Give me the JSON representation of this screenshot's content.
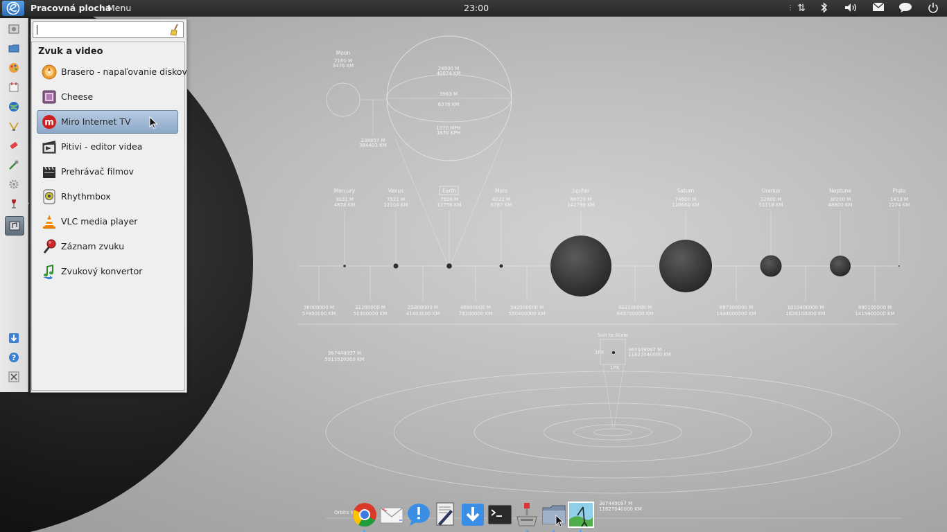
{
  "top_panel": {
    "desktop_label": "Pracovná plocha",
    "menu_label": "Menu",
    "clock": "23:00"
  },
  "search": {
    "value": "",
    "placeholder": ""
  },
  "menu": {
    "category": "Zvuk a video",
    "items": [
      {
        "label": "Brasero - napaľovanie diskov",
        "icon": "disc-burner-icon"
      },
      {
        "label": "Cheese",
        "icon": "webcam-icon"
      },
      {
        "label": "Miro Internet TV",
        "icon": "miro-icon",
        "selected": true
      },
      {
        "label": "Pitivi - editor videa",
        "icon": "video-editor-icon"
      },
      {
        "label": "Prehrávač filmov",
        "icon": "clapperboard-icon"
      },
      {
        "label": "Rhythmbox",
        "icon": "rhythmbox-icon"
      },
      {
        "label": "VLC media player",
        "icon": "vlc-cone-icon"
      },
      {
        "label": "Záznam zvuku",
        "icon": "microphone-icon"
      },
      {
        "label": "Zvukový konvertor",
        "icon": "audio-converter-icon"
      }
    ]
  },
  "wallpaper": {
    "moon": {
      "name": "Moon",
      "line1": "2160 M",
      "line2": "3476 KM"
    },
    "earth_big": {
      "l1": "24900 M",
      "l2": "40074 KM",
      "l3": "3963 M",
      "l4": "6378 KM",
      "l5": "1070 MPH",
      "l6": "1670 KPH"
    },
    "moon_distance": {
      "l1": "238857 M",
      "l2": "384403 KM"
    },
    "planets": [
      {
        "name": "Mercury",
        "d1": "3031 M",
        "d2": "4878 KM"
      },
      {
        "name": "Venus",
        "d1": "7521 M",
        "d2": "12104 KM"
      },
      {
        "name": "Earth",
        "d1": "7926 M",
        "d2": "12756 KM"
      },
      {
        "name": "Mars",
        "d1": "4222 M",
        "d2": "6787 KM"
      },
      {
        "name": "Jupiter",
        "d1": "88729 M",
        "d2": "142796 KM"
      },
      {
        "name": "Saturn",
        "d1": "74600 M",
        "d2": "120660 KM"
      },
      {
        "name": "Uranus",
        "d1": "32600 M",
        "d2": "51118 KM"
      },
      {
        "name": "Neptune",
        "d1": "30200 M",
        "d2": "48600 KM"
      },
      {
        "name": "Pluto",
        "d1": "1413 M",
        "d2": "2274 KM"
      }
    ],
    "distances": [
      {
        "l1": "36000000 M",
        "l2": "57900000 KM"
      },
      {
        "l1": "31200000 M",
        "l2": "50300000 KM"
      },
      {
        "l1": "25800000 M",
        "l2": "41400000 KM"
      },
      {
        "l1": "48600000 M",
        "l2": "78300000 KM"
      },
      {
        "l1": "342000000 M",
        "l2": "550400000 KM"
      },
      {
        "l1": "403100000 M",
        "l2": "648700000 KM"
      },
      {
        "l1": "897300000 M",
        "l2": "1444000000 KM"
      },
      {
        "l1": "1010400000 M",
        "l2": "1626100000 KM"
      },
      {
        "l1": "880100000 M",
        "l2": "1415900000 KM"
      }
    ],
    "total": {
      "l1": "367449097 M",
      "l2": "5913520000 KM"
    },
    "sun_scale": {
      "title": "Sun to Scale",
      "l1": "367449097 M",
      "l2": "11827040000 KM",
      "side": "1PX",
      "bottom": "1PX"
    },
    "orbit_label": "Orbits to Scale",
    "bottom_text": {
      "l1": "367449097 M",
      "l2": "11827040000 KM"
    }
  },
  "colors": {
    "selection": "#8ca8c8",
    "panel": "#2e2e2e",
    "accent": "#3b82d6"
  }
}
